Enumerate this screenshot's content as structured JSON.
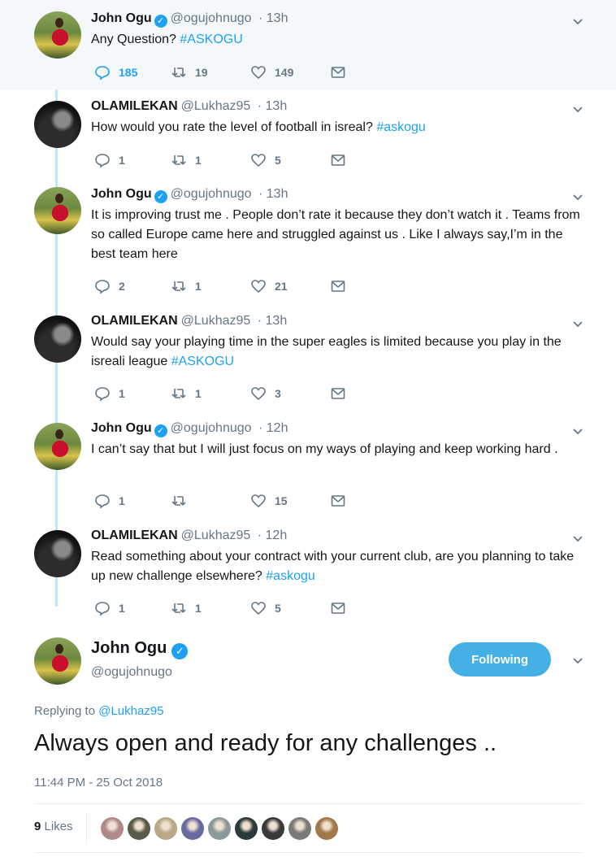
{
  "tweets": [
    {
      "name": "John Ogu",
      "verified": true,
      "handle": "@ogujohnugo",
      "time": "· 13h",
      "text": "Any Question? ",
      "hashtag": "#ASKOGU",
      "replies": "185",
      "retweets": "19",
      "likes": "149"
    },
    {
      "name": "OLAMILEKAN",
      "verified": false,
      "handle": "@Lukhaz95",
      "time": "· 13h",
      "text": "How would you rate the level of football in isreal? ",
      "hashtag": "#askogu",
      "replies": "1",
      "retweets": "1",
      "likes": "5"
    },
    {
      "name": "John Ogu",
      "verified": true,
      "handle": "@ogujohnugo",
      "time": "· 13h",
      "text": "It is improving trust me . People don’t rate it because they don’t watch it . Teams from so called Europe came here and struggled against us . Like I always say,I’m in the best team here",
      "hashtag": "",
      "replies": "2",
      "retweets": "1",
      "likes": "21"
    },
    {
      "name": "OLAMILEKAN",
      "verified": false,
      "handle": "@Lukhaz95",
      "time": "· 13h",
      "text": "Would say your playing time in the super eagles is limited because you play in the isreali league ",
      "hashtag": "#ASKOGU",
      "replies": "1",
      "retweets": "1",
      "likes": "3"
    },
    {
      "name": "John Ogu",
      "verified": true,
      "handle": "@ogujohnugo",
      "time": "· 12h",
      "text": "I can’t say that but I will just focus on my ways of playing and keep working hard .",
      "hashtag": "",
      "replies": "1",
      "retweets": "",
      "likes": "15"
    },
    {
      "name": "OLAMILEKAN",
      "verified": false,
      "handle": "@Lukhaz95",
      "time": "· 12h",
      "text": "Read something about your contract with your current club, are you planning to take up new challenge elsewhere? ",
      "hashtag": "#askogu",
      "replies": "1",
      "retweets": "1",
      "likes": "5"
    }
  ],
  "main_tweet": {
    "name": "John Ogu",
    "handle": "@ogujohnugo",
    "follow_label": "Following",
    "replying_prefix": "Replying to ",
    "replying_to": "@Lukhaz95",
    "text": "Always open and ready for any challenges ..",
    "timestamp": "11:44 PM - 25 Oct 2018",
    "likes_count": "9",
    "likes_label": "Likes",
    "liker_colors": [
      "#b08a8a",
      "#5a5a48",
      "#b8a888",
      "#6a6aa0",
      "#8a9a9a",
      "#2a3a3a",
      "#3a3a3a",
      "#7a7a7a",
      "#a0784a"
    ]
  },
  "colors": {
    "accent": "#1da1f2",
    "muted": "#657786",
    "thread": "#bfe6f5",
    "highlight_bg": "#f5f8fa"
  }
}
